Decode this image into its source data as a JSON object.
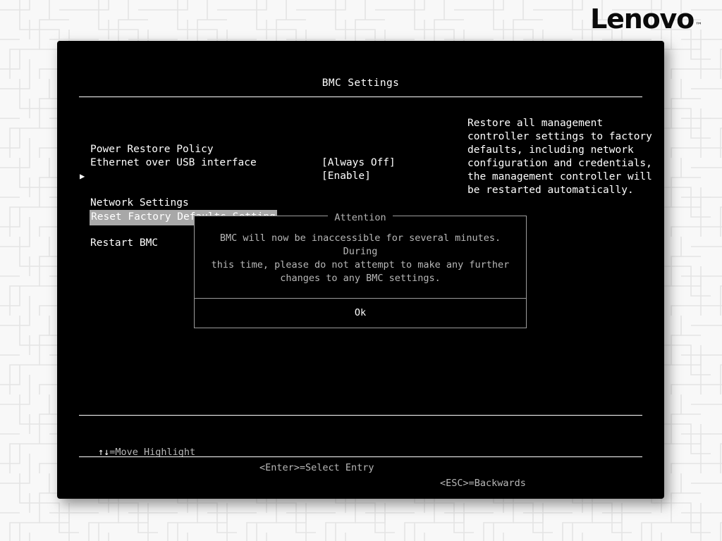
{
  "brand": {
    "name": "Lenovo",
    "trademark": "™"
  },
  "screen": {
    "title": "BMC Settings"
  },
  "menu": {
    "items": [
      {
        "label": "Power Restore Policy",
        "value": "[Always Off]",
        "type": "option",
        "highlighted": false
      },
      {
        "label": "Ethernet over USB interface",
        "value": "[Enable]",
        "type": "option",
        "highlighted": false
      },
      {
        "label": "Network Settings",
        "value": "",
        "type": "submenu",
        "highlighted": false
      },
      {
        "label": "Reset Factory Defaults Setting",
        "value": "",
        "type": "action",
        "highlighted": true
      },
      {
        "label": "Restart BMC",
        "value": "",
        "type": "action",
        "highlighted": false
      }
    ]
  },
  "help": {
    "text": "Restore all management\ncontroller settings to factory\ndefaults, including network\nconfiguration and credentials,\nthe management controller will\nbe restarted automatically."
  },
  "dialog": {
    "title": "Attention",
    "message": "BMC will now be inaccessible for several minutes. During\nthis time, please do not attempt to make any further\nchanges to any BMC settings.",
    "ok_label": "Ok"
  },
  "footer": {
    "move_arrows": "↑↓",
    "move_label": "=Move Highlight",
    "enter_hint": "<Enter>=Select Entry",
    "esc_hint": "<ESC>=Backwards"
  },
  "colors": {
    "panel_background": "#000000",
    "text": "#ffffff",
    "dim_text": "#b8b8b8",
    "highlight_background": "#a8a8a8",
    "dialog_border": "#9c9c9c",
    "page_background": "#f8f8f8",
    "pattern_line": "#e3e3e3"
  }
}
